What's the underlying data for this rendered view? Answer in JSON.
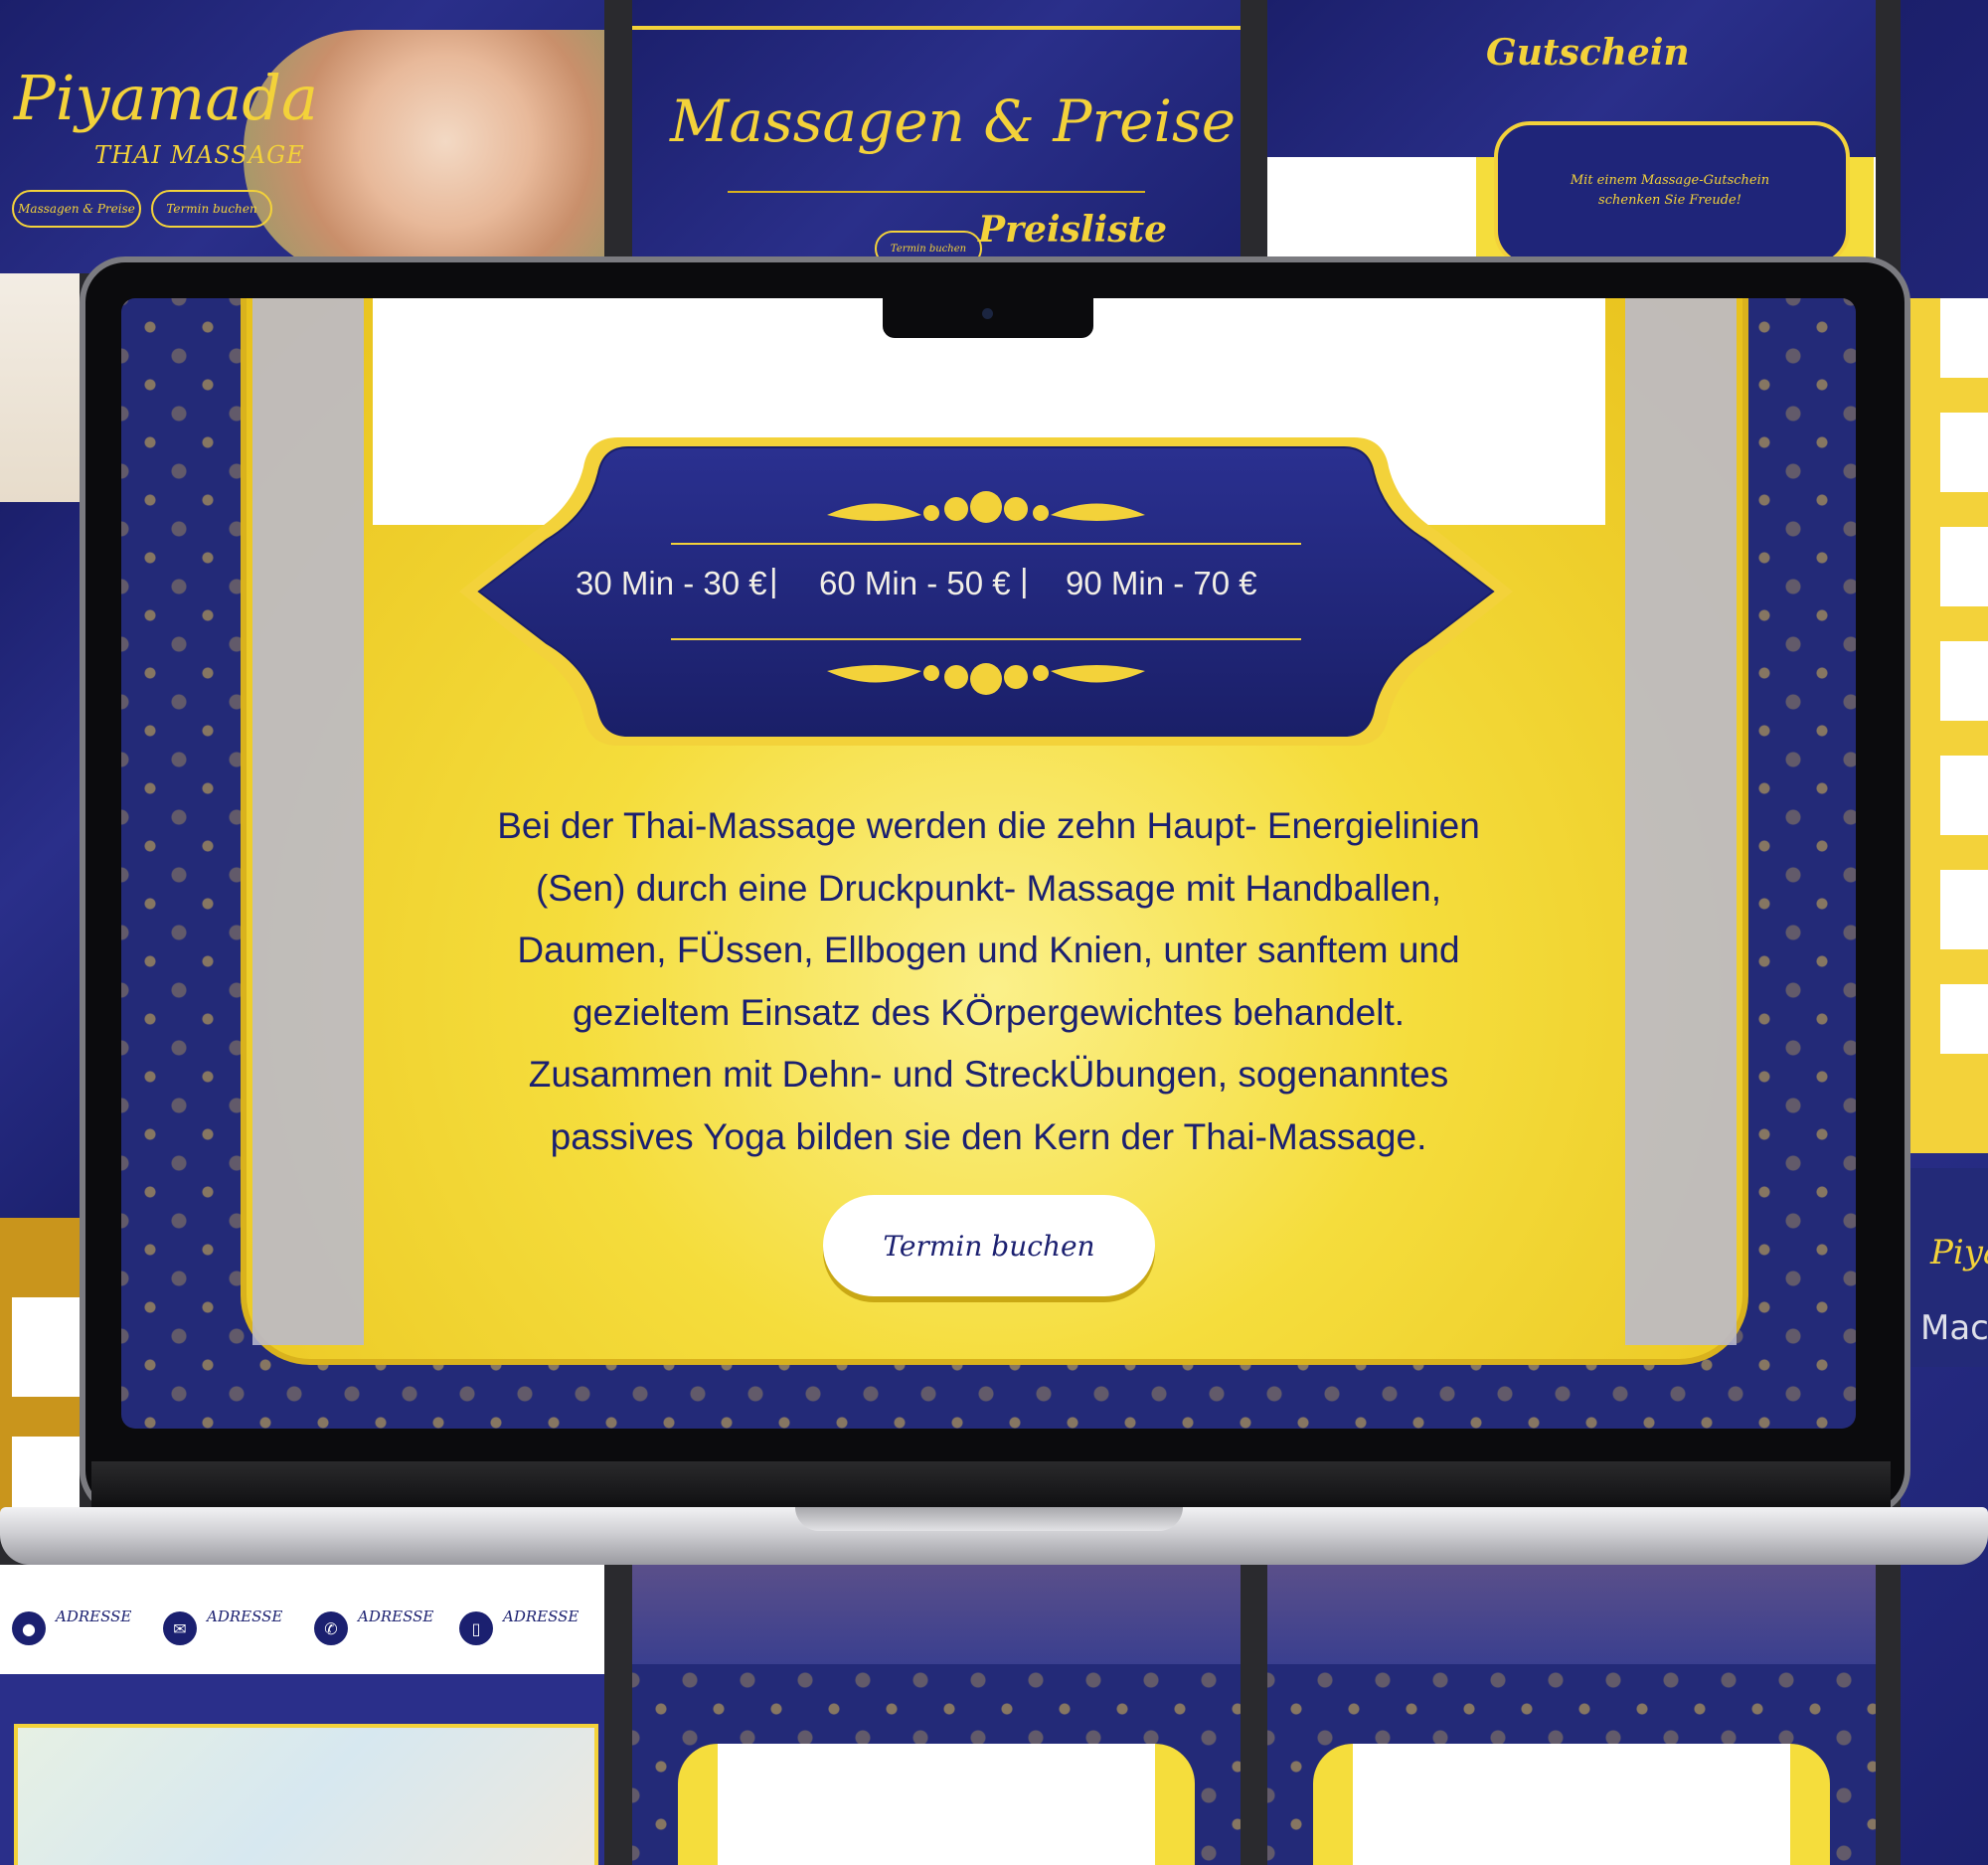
{
  "background_panels": {
    "brand_name": "Piyamada",
    "brand_tagline": "THAI MASSAGE",
    "hero_buttons": [
      "Massagen & Preise",
      "Termin buchen"
    ],
    "prices_heading": "Massagen & Preise",
    "price_list_heading": "Preisliste",
    "price_list_button": "Termin buchen",
    "voucher_heading": "Gutschein",
    "voucher_text": "Mit einem Massage-Gutschein schenken Sie Freude!",
    "contact_items": [
      {
        "icon": "location-pin-icon",
        "label": "ADRESSE"
      },
      {
        "icon": "mail-icon",
        "label": "ADRESSE"
      },
      {
        "icon": "phone-icon",
        "label": "ADRESSE"
      },
      {
        "icon": "mobile-icon",
        "label": "ADRESSE"
      }
    ],
    "right_edge_brand": "Piya",
    "right_edge_text": "Mach"
  },
  "screen": {
    "prices": [
      {
        "duration": "30 Min",
        "price": "30 €",
        "text": "30 Min - 30 €"
      },
      {
        "duration": "60 Min",
        "price": "50 €",
        "text": "60 Min - 50 €"
      },
      {
        "duration": "90 Min",
        "price": "70 €",
        "text": "90 Min - 70 €"
      }
    ],
    "separator": "|",
    "description_lines": [
      "Bei der Thai-Massage werden die zehn Haupt- Energielinien",
      "(Sen) durch eine Druckpunkt- Massage mit Handballen,",
      "Daumen, FÜssen, Ellbogen und Knien, unter sanftem und",
      "gezieltem Einsatz des KÖrpergewichtes behandelt.",
      "Zusammen mit Dehn- und StreckÜbungen, sogenanntes",
      "passives Yoga bilden sie den Kern der Thai-Massage."
    ],
    "cta_label": "Termin buchen"
  },
  "colors": {
    "navy": "#1b2070",
    "gold": "#f3d23a",
    "gold_dark": "#d9b21d",
    "white": "#ffffff"
  }
}
